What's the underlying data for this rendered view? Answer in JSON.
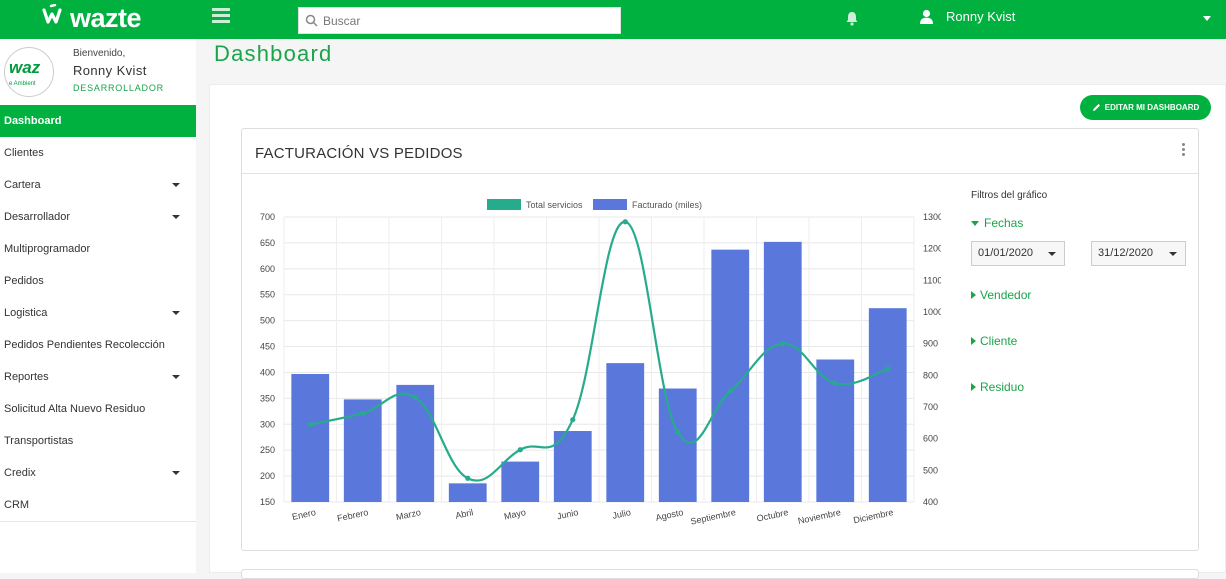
{
  "brand": {
    "logo_mark": "ꟽ",
    "logo_text": "wazte"
  },
  "header": {
    "search_placeholder": "Buscar",
    "user_name": "Ronny Kvist"
  },
  "profile": {
    "welcome": "Bienvenido,",
    "name": "Ronny Kvist",
    "role": "DESARROLLADOR",
    "avatar_text": "waz",
    "avatar_sub": "e Ambient"
  },
  "sidebar": {
    "items": [
      {
        "label": "Dashboard",
        "active": true,
        "has_caret": false
      },
      {
        "label": "Clientes",
        "has_caret": false
      },
      {
        "label": "Cartera",
        "has_caret": true
      },
      {
        "label": "Desarrollador",
        "has_caret": true
      },
      {
        "label": "Multiprogramador",
        "has_caret": false
      },
      {
        "label": "Pedidos",
        "has_caret": false
      },
      {
        "label": "Logistica",
        "has_caret": true
      },
      {
        "label": "Pedidos Pendientes Recolección",
        "has_caret": false
      },
      {
        "label": "Reportes",
        "has_caret": true
      },
      {
        "label": "Solicitud Alta Nuevo Residuo",
        "has_caret": false
      },
      {
        "label": "Transportistas",
        "has_caret": false
      },
      {
        "label": "Credix",
        "has_caret": true
      },
      {
        "label": "CRM",
        "has_caret": false
      }
    ]
  },
  "page": {
    "title": "Dashboard",
    "edit_button": "EDITAR MI DASHBOARD"
  },
  "card": {
    "title": "FACTURACIÓN VS PEDIDOS"
  },
  "filters": {
    "title": "Filtros del gráfico",
    "fechas": "Fechas",
    "date_from": "01/01/2020",
    "date_to": "31/12/2020",
    "vendedor": "Vendedor",
    "cliente": "Cliente",
    "residuo": "Residuo"
  },
  "colors": {
    "brand_green": "#00b140",
    "bar": "#5a78dc",
    "line": "#26ab8c"
  },
  "chart_data": {
    "type": "bar",
    "categories": [
      "Enero",
      "Febrero",
      "Marzo",
      "Abril",
      "Mayo",
      "Junio",
      "Julio",
      "Agosto",
      "Septiembre",
      "Octubre",
      "Noviembre",
      "Diciembre"
    ],
    "series": [
      {
        "name": "Facturado (miles)",
        "type": "bar",
        "axis": "left",
        "values": [
          397,
          348,
          376,
          186,
          228,
          287,
          418,
          369,
          637,
          652,
          425,
          524
        ]
      },
      {
        "name": "Total servicios",
        "type": "line",
        "axis": "right",
        "values": [
          645,
          680,
          730,
          475,
          565,
          660,
          1285,
          620,
          750,
          900,
          775,
          820
        ]
      }
    ],
    "y_left": {
      "min": 150,
      "max": 700,
      "ticks": [
        150,
        200,
        250,
        300,
        350,
        400,
        450,
        500,
        550,
        600,
        650,
        700
      ]
    },
    "y_right": {
      "min": 400,
      "max": 1300,
      "ticks": [
        400,
        500,
        600,
        700,
        800,
        900,
        1000,
        1100,
        1200,
        1300
      ]
    },
    "legend_position": "top-center",
    "grid": true
  }
}
